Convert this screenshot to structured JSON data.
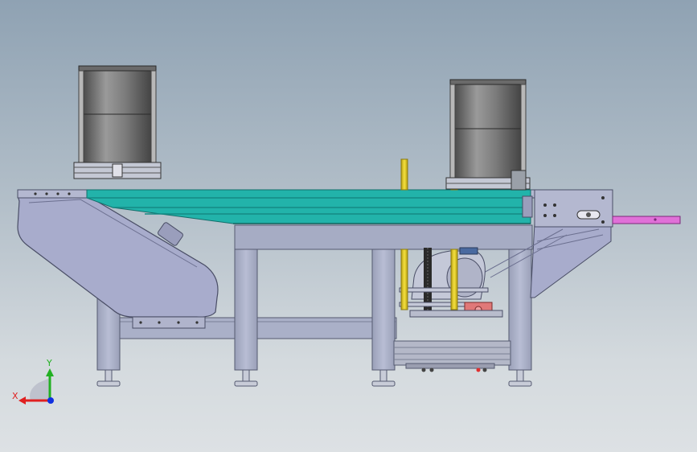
{
  "triad": {
    "x_label": "X",
    "y_label": "Y",
    "x_color": "#e02020",
    "y_color": "#22b022",
    "z_color": "#1030e0"
  },
  "colors": {
    "belt": "#20b0a8",
    "frame": "#a9aec8",
    "guide_post": "#e8d020",
    "drum": "#6a6a6a",
    "rod": "#e070d8",
    "motor_block": "#e07878"
  }
}
